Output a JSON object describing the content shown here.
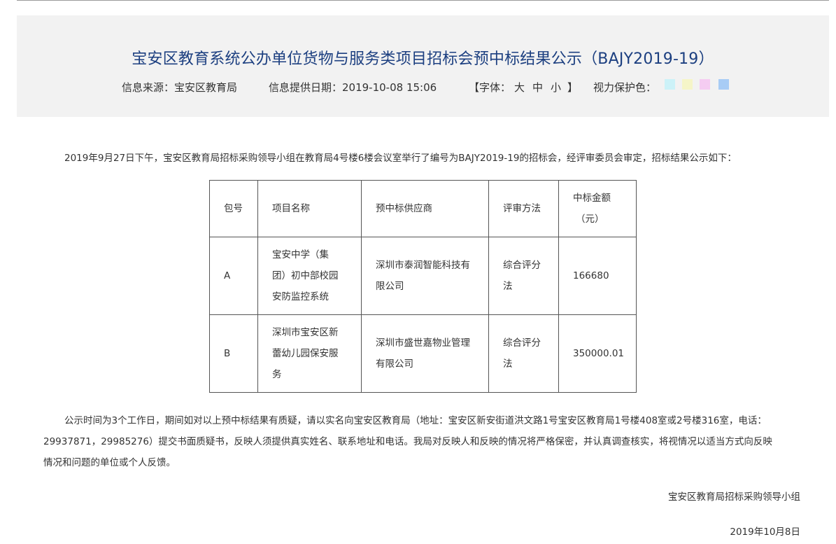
{
  "header": {
    "title": "宝安区教育系统公办单位货物与服务类项目招标会预中标结果公示（BAJY2019-19）",
    "source_label": "信息来源：宝安区教育局",
    "date_label": "信息提供日期：2019-10-08 15:06",
    "font_label_open": "【字体：",
    "font_large": "大",
    "font_medium": "中",
    "font_small": "小",
    "font_label_close": "】",
    "eye_label": "视力保护色：",
    "eye_colors": [
      "#ccf2f8",
      "#f5f5c8",
      "#f5ccf2",
      "#a8ccf5"
    ]
  },
  "intro": "2019年9月27日下午，宝安区教育局招标采购领导小组在教育局4号楼6楼会议室举行了编号为BAJY2019-19的招标会，经评审委员会审定，招标结果公示如下：",
  "table": {
    "headers": {
      "package": "包号",
      "project": "项目名称",
      "supplier": "预中标供应商",
      "method": "评审方法",
      "amount_1": "中标金额",
      "amount_2": "（元）"
    },
    "rows": [
      {
        "package": "A",
        "project": [
          "宝安中学（集",
          "团）初中部校园",
          "安防监控系统"
        ],
        "supplier": [
          "深圳市泰润智能科技有",
          "限公司"
        ],
        "method": [
          "综合评分",
          "法"
        ],
        "amount": "166680"
      },
      {
        "package": "B",
        "project": [
          "深圳市宝安区新",
          "蕾幼儿园保安服",
          "务"
        ],
        "supplier": [
          "深圳市盛世嘉物业管理",
          "有限公司"
        ],
        "method": [
          "综合评分",
          "法"
        ],
        "amount": "350000.01"
      }
    ]
  },
  "notice": [
    "公示时间为3个工作日，期间如对以上预中标结果有质疑，请以实名向宝安区教育局（地址：宝安区新安街道洪文路1号宝安区教育局1号楼408室或2号楼316室，电话：",
    "29937871，29985276）提交书面质疑书，反映人须提供真实姓名、联系地址和电话。我局对反映人和反映的情况将严格保密，并认真调查核实，将视情况以适当方式向反映",
    "情况和问题的单位或个人反馈。"
  ],
  "signature": "宝安区教育局招标采购领导小组",
  "date": "2019年10月8日"
}
